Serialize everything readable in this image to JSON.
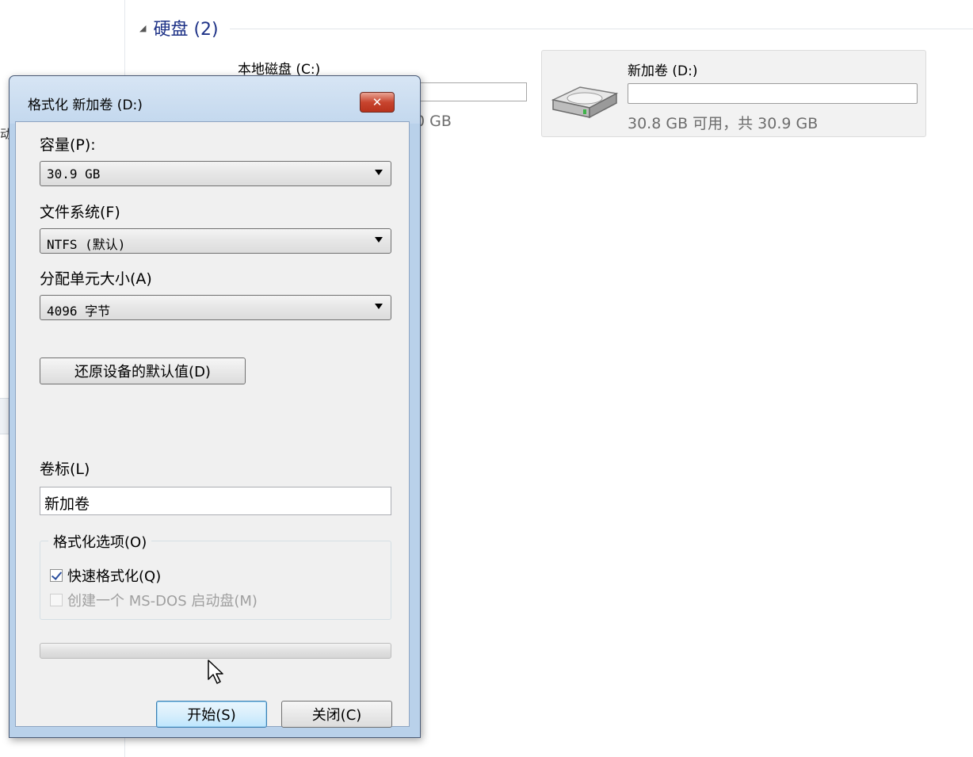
{
  "explorer": {
    "group": {
      "title": "硬盘 (2)"
    },
    "drive_c": {
      "name": "本地磁盘 (C:)",
      "size_partial": "0 GB"
    },
    "drive_d": {
      "name": "新加卷 (D:)",
      "size": "30.8 GB 可用，共 30.9 GB"
    },
    "nav_partial": "动"
  },
  "dialog": {
    "title": "格式化 新加卷 (D:)",
    "capacity": {
      "label": "容量(P):",
      "value": "30.9 GB"
    },
    "filesystem": {
      "label": "文件系统(F)",
      "value": "NTFS (默认)"
    },
    "allocation": {
      "label": "分配单元大小(A)",
      "value": "4096 字节"
    },
    "restore_button": "还原设备的默认值(D)",
    "volume_label": {
      "label": "卷标(L)",
      "value": "新加卷"
    },
    "options": {
      "title": "格式化选项(O)",
      "quick_format": {
        "label": "快速格式化(Q)",
        "checked": true
      },
      "msdos_boot": {
        "label": "创建一个 MS-DOS 启动盘(M)",
        "checked": false,
        "enabled": false
      }
    },
    "progress": 0,
    "start_button": "开始(S)",
    "close_button": "关闭(C)"
  },
  "colors": {
    "accent": "#1e3287",
    "titlebar": "#c3d8ee",
    "close": "#c8452f"
  }
}
